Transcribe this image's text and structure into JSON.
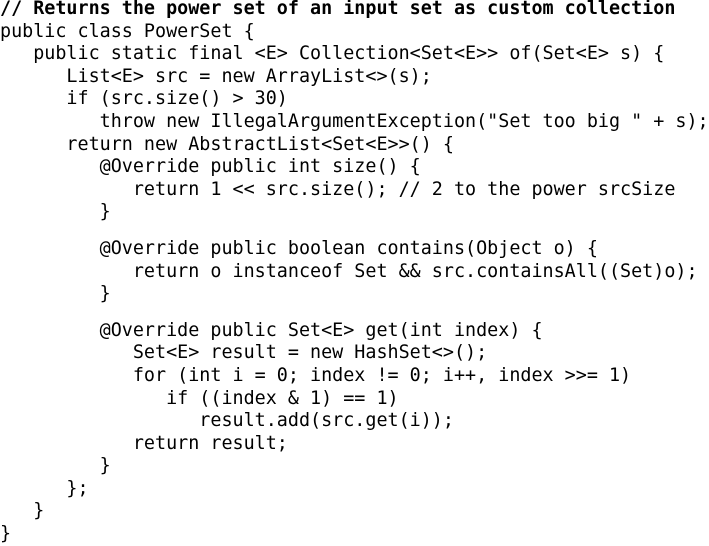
{
  "code": {
    "lines": [
      "// Returns the power set of an input set as custom collection",
      "public class PowerSet {",
      "   public static final <E> Collection<Set<E>> of(Set<E> s) {",
      "      List<E> src = new ArrayList<>(s);",
      "      if (src.size() > 30)",
      "         throw new IllegalArgumentException(\"Set too big \" + s);",
      "      return new AbstractList<Set<E>>() {",
      "         @Override public int size() {",
      "            return 1 << src.size(); // 2 to the power srcSize",
      "         }",
      "",
      "         @Override public boolean contains(Object o) {",
      "            return o instanceof Set && src.containsAll((Set)o);",
      "         }",
      "",
      "         @Override public Set<E> get(int index) {",
      "            Set<E> result = new HashSet<>();",
      "            for (int i = 0; index != 0; i++, index >>= 1)",
      "               if ((index & 1) == 1)",
      "                  result.add(src.get(i));",
      "            return result;",
      "         }",
      "      };",
      "   }",
      "}"
    ]
  }
}
